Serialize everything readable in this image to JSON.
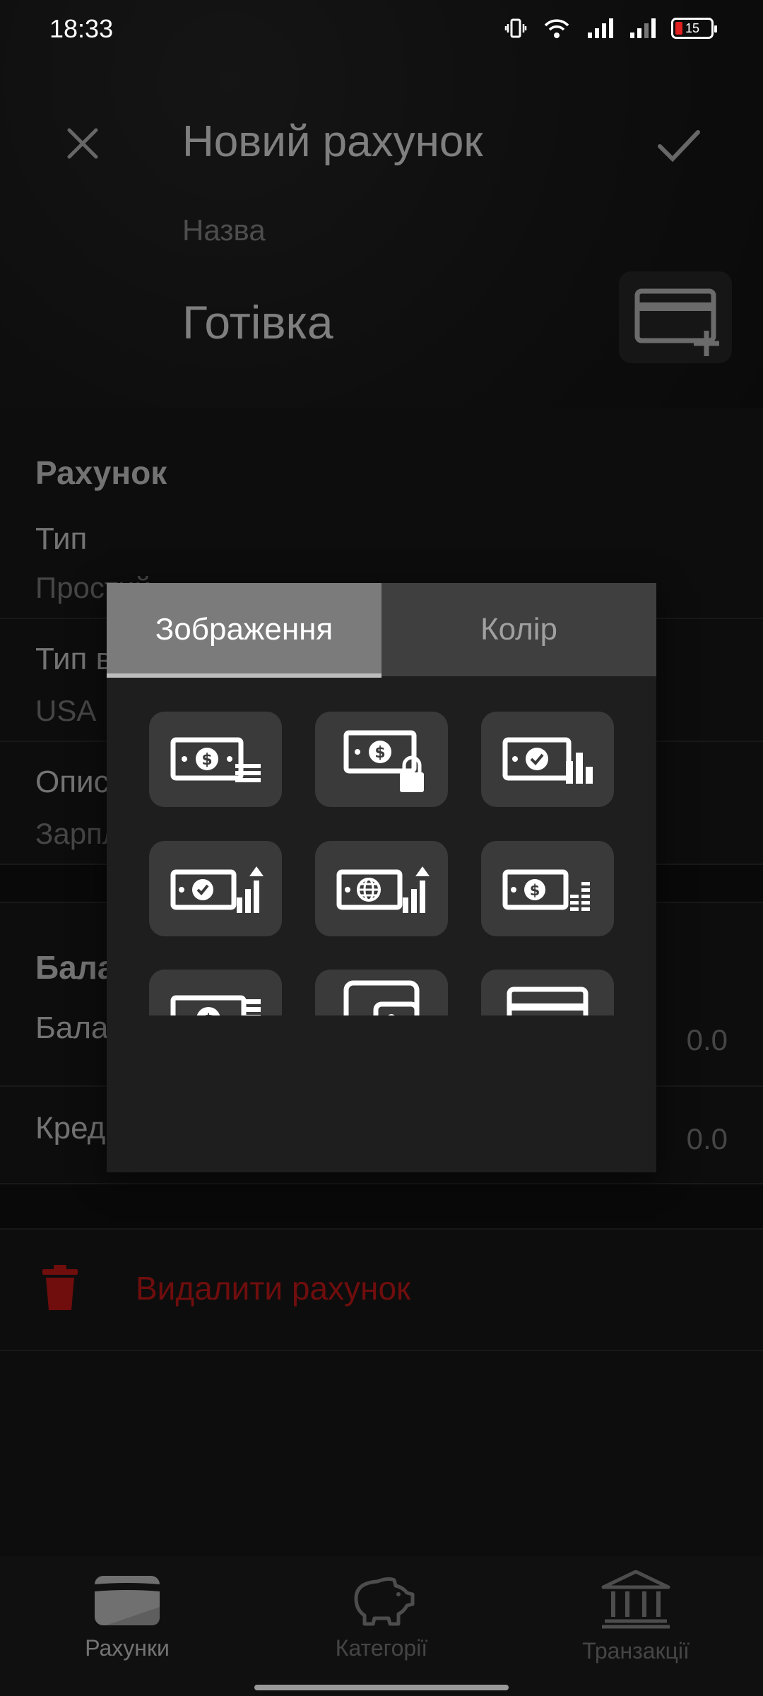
{
  "status_bar": {
    "time": "18:33",
    "battery": "15"
  },
  "header": {
    "title": "Новий рахунок",
    "name_label": "Назва",
    "name_value": "Готівка"
  },
  "account_section": {
    "title": "Рахунок",
    "type_label": "Тип",
    "type_value": "Простий",
    "currency_label": "Тип валюти",
    "currency_value": "USA",
    "description_label": "Опис",
    "description_value": "Зарплата"
  },
  "balance_section": {
    "title": "Баланс",
    "balance_label": "Баланс",
    "balance_value": "0.0",
    "credit_label": "Кредит",
    "credit_value": "0.0"
  },
  "delete": {
    "label": "Видалити рахунок"
  },
  "dialog": {
    "tabs": [
      "Зображення",
      "Колір"
    ],
    "active_tab": "Зображення",
    "icons": [
      "cash-stack-icon",
      "cash-lock-icon",
      "cash-check-chart-icon",
      "cash-check-growth-icon",
      "cash-globe-growth-icon",
      "cash-coins-chart-icon",
      "cash-bills-icon",
      "wallet-icon",
      "card-icon",
      "piggy-partial-icon",
      "card-partial-icon",
      "card-partial-icon-2"
    ]
  },
  "bottom_nav": {
    "items": [
      {
        "label": "Рахунки",
        "icon": "wallet-icon",
        "active": true
      },
      {
        "label": "Категорії",
        "icon": "piggy-bank-icon",
        "active": false
      },
      {
        "label": "Транзакції",
        "icon": "bank-icon",
        "active": false
      }
    ]
  },
  "colors": {
    "accent_red": "#e01b1b",
    "active_tab": "#7b7b7b",
    "tile": "#3a3a3a"
  }
}
